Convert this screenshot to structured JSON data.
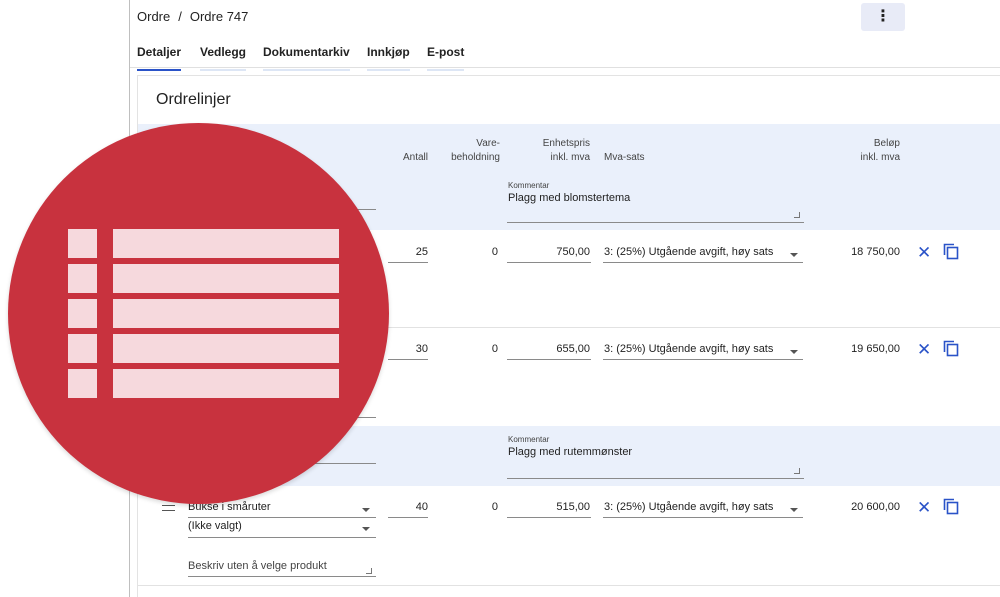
{
  "breadcrumb": {
    "root": "Ordre",
    "separator": "/",
    "current": "Ordre 747"
  },
  "menu": {
    "icon": "more-vertical-icon",
    "glyph": "⋮"
  },
  "tabs": [
    "Detaljer",
    "Vedlegg",
    "Dokumentarkiv",
    "Innkjøp",
    "E-post"
  ],
  "active_tab": "Detaljer",
  "section": {
    "title": "Ordrelinjer"
  },
  "table": {
    "headers": {
      "antall": "Antall",
      "vare_line1": "Vare-",
      "vare_line2": "beholdning",
      "enhet_line1": "Enhetspris",
      "enhet_line2": "inkl. mva",
      "mva": "Mva-sats",
      "belop_line1": "Beløp",
      "belop_line2": "inkl. mva"
    }
  },
  "comments": [
    {
      "label": "Kommentar",
      "text": "Plagg med blomstertema"
    },
    {
      "label": "Kommentar",
      "text": "Plagg med rutemmønster"
    }
  ],
  "rows": [
    {
      "antall": "25",
      "beholdning": "0",
      "enhetspris": "750,00",
      "mva": "3: (25%) Utgående avgift, høy sats",
      "belop": "18 750,00"
    },
    {
      "antall": "30",
      "beholdning": "0",
      "enhetspris": "655,00",
      "mva": "3: (25%) Utgående avgift, høy sats",
      "belop": "19 650,00"
    },
    {
      "antall": "40",
      "beholdning": "0",
      "enhetspris": "515,00",
      "mva": "3: (25%) Utgående avgift, høy sats",
      "belop": "20 600,00",
      "product": "Bukse i småruter",
      "variant": "(Ikke valgt)",
      "description_placeholder": "Beskriv uten å velge produkt"
    }
  ],
  "icons": {
    "remove": "close-icon",
    "copy": "copy-icon",
    "overlay": "list-icon"
  },
  "colors": {
    "accent": "#2a53c8",
    "overlay": "#c8323e",
    "header_band": "#eaf0fb"
  }
}
